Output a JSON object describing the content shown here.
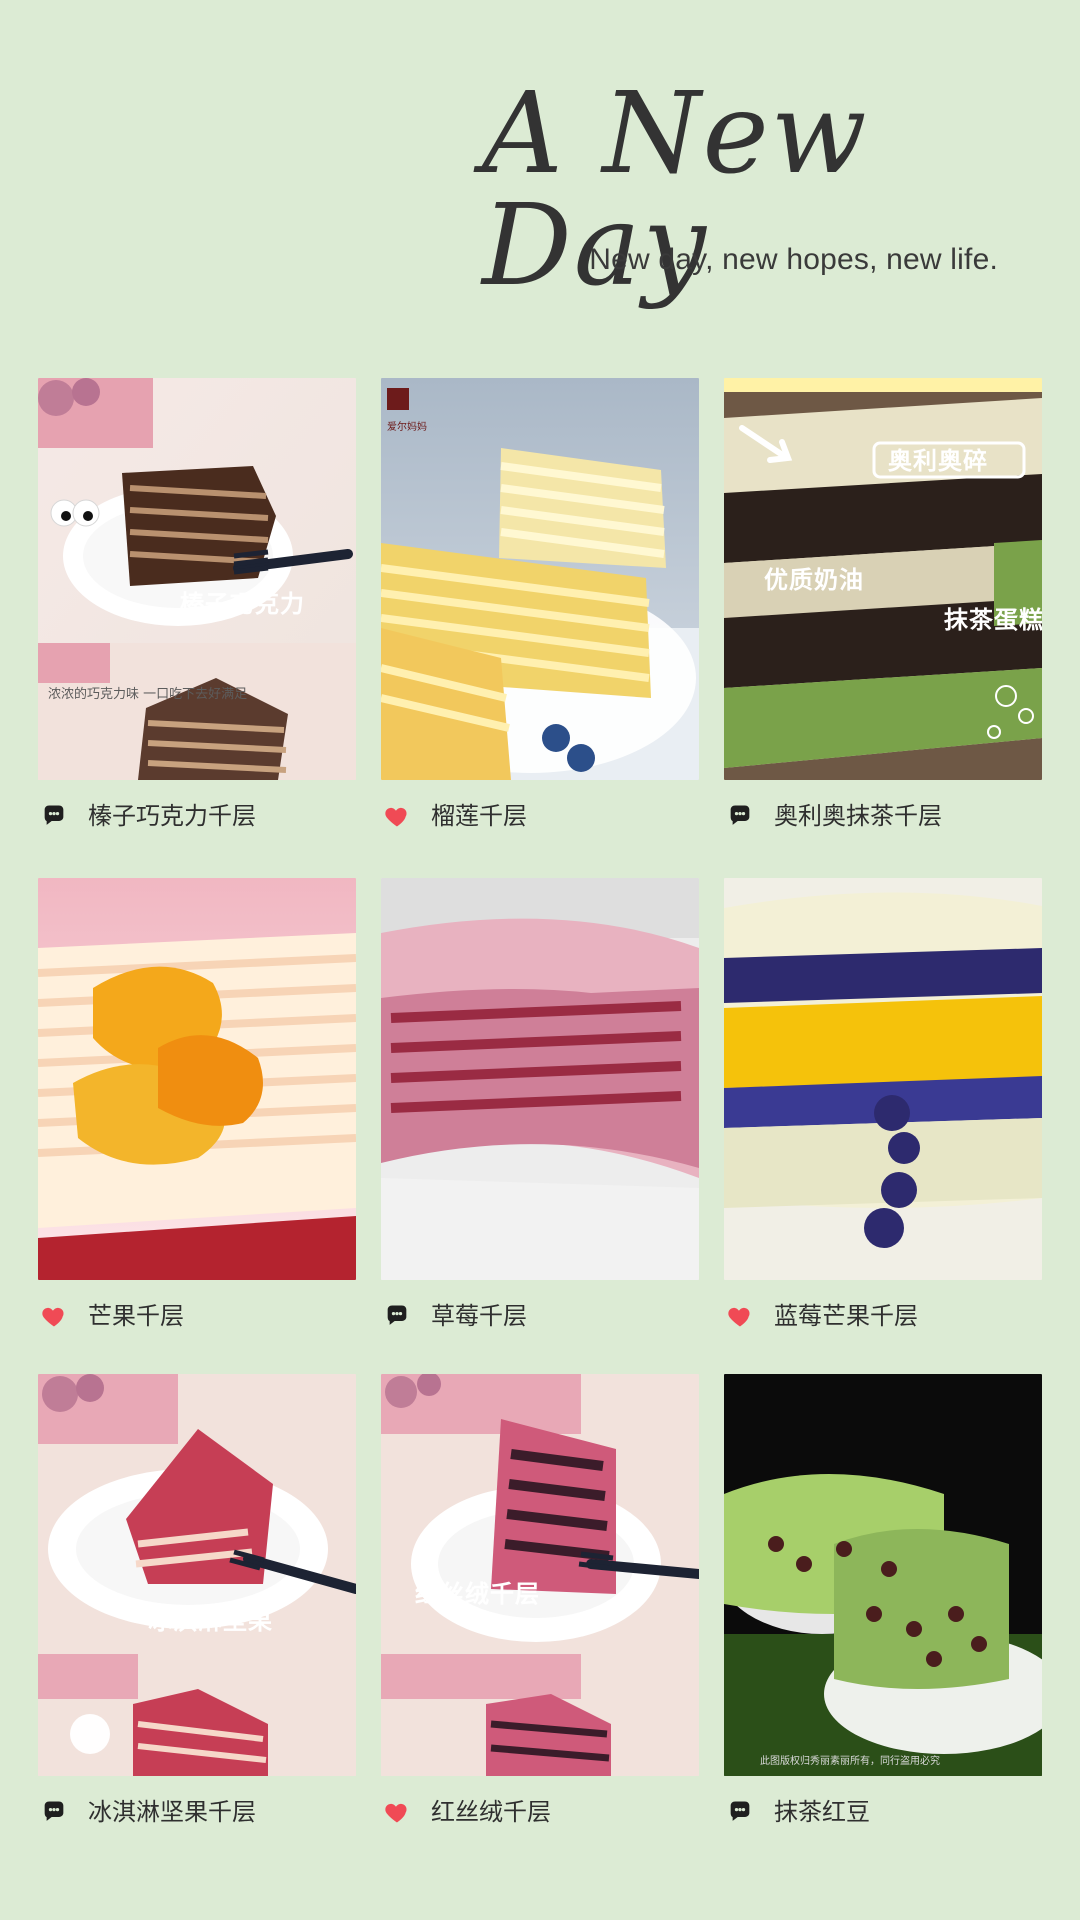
{
  "header": {
    "title": "A New Day",
    "subtitle": "New day, new hopes, new life."
  },
  "items": [
    {
      "label": "榛子巧克力千层",
      "icon": "chat-icon",
      "sticker": "榛子巧克力",
      "sticker2": "浓浓的巧克力味 一口吃下去好满足",
      "accent": "#5a3a2a"
    },
    {
      "label": "榴莲千层",
      "icon": "heart-icon",
      "brand_small": "爱尔妈妈",
      "accent": "#f0c94a"
    },
    {
      "label": "奥利奥抹茶千层",
      "icon": "chat-icon",
      "sticker": "奥利奥碎",
      "sticker2": "优质奶油",
      "sticker3": "抹茶蛋糕",
      "accent": "#7aa24a"
    },
    {
      "label": "芒果千层",
      "icon": "heart-icon",
      "accent": "#f1b020"
    },
    {
      "label": "草莓千层",
      "icon": "chat-icon",
      "accent": "#b85a76"
    },
    {
      "label": "蓝莓芒果千层",
      "icon": "heart-icon",
      "accent": "#2d2a6e"
    },
    {
      "label": "冰淇淋坚果千层",
      "icon": "chat-icon",
      "sticker": "冰淇淋坚果",
      "accent": "#c63e55"
    },
    {
      "label": "红丝绒千层",
      "icon": "heart-icon",
      "sticker": "红丝绒千层",
      "accent": "#c94c6a"
    },
    {
      "label": "抹茶红豆",
      "icon": "chat-icon",
      "footer_note": "此图版权归秀丽素丽所有，同行盗用必究",
      "accent": "#a7cf6a"
    }
  ],
  "colors": {
    "background": "#dcebd4",
    "text": "#2f2f2f",
    "heart": "#f04a55",
    "chat": "#1f1f1f"
  }
}
